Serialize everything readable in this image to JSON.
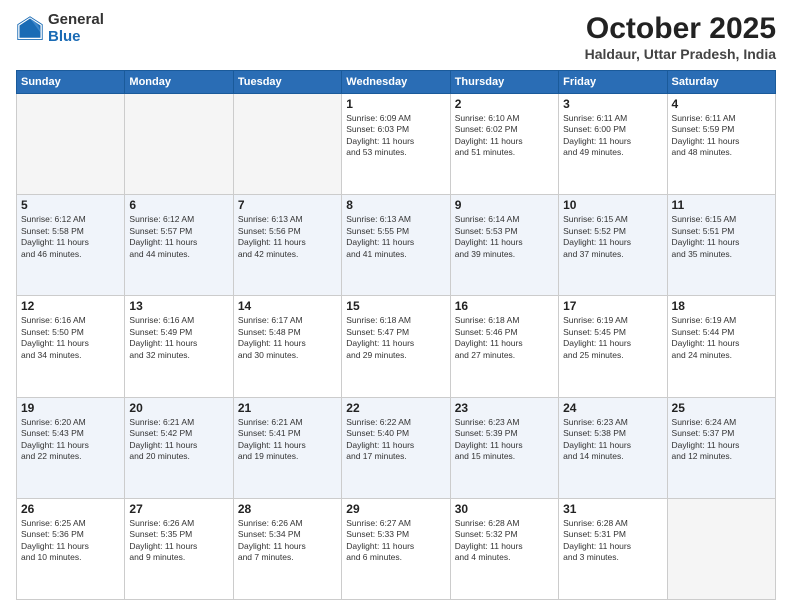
{
  "header": {
    "logo_general": "General",
    "logo_blue": "Blue",
    "title": "October 2025",
    "location": "Haldaur, Uttar Pradesh, India"
  },
  "weekdays": [
    "Sunday",
    "Monday",
    "Tuesday",
    "Wednesday",
    "Thursday",
    "Friday",
    "Saturday"
  ],
  "weeks": [
    [
      {
        "day": "",
        "info": ""
      },
      {
        "day": "",
        "info": ""
      },
      {
        "day": "",
        "info": ""
      },
      {
        "day": "1",
        "info": "Sunrise: 6:09 AM\nSunset: 6:03 PM\nDaylight: 11 hours\nand 53 minutes."
      },
      {
        "day": "2",
        "info": "Sunrise: 6:10 AM\nSunset: 6:02 PM\nDaylight: 11 hours\nand 51 minutes."
      },
      {
        "day": "3",
        "info": "Sunrise: 6:11 AM\nSunset: 6:00 PM\nDaylight: 11 hours\nand 49 minutes."
      },
      {
        "day": "4",
        "info": "Sunrise: 6:11 AM\nSunset: 5:59 PM\nDaylight: 11 hours\nand 48 minutes."
      }
    ],
    [
      {
        "day": "5",
        "info": "Sunrise: 6:12 AM\nSunset: 5:58 PM\nDaylight: 11 hours\nand 46 minutes."
      },
      {
        "day": "6",
        "info": "Sunrise: 6:12 AM\nSunset: 5:57 PM\nDaylight: 11 hours\nand 44 minutes."
      },
      {
        "day": "7",
        "info": "Sunrise: 6:13 AM\nSunset: 5:56 PM\nDaylight: 11 hours\nand 42 minutes."
      },
      {
        "day": "8",
        "info": "Sunrise: 6:13 AM\nSunset: 5:55 PM\nDaylight: 11 hours\nand 41 minutes."
      },
      {
        "day": "9",
        "info": "Sunrise: 6:14 AM\nSunset: 5:53 PM\nDaylight: 11 hours\nand 39 minutes."
      },
      {
        "day": "10",
        "info": "Sunrise: 6:15 AM\nSunset: 5:52 PM\nDaylight: 11 hours\nand 37 minutes."
      },
      {
        "day": "11",
        "info": "Sunrise: 6:15 AM\nSunset: 5:51 PM\nDaylight: 11 hours\nand 35 minutes."
      }
    ],
    [
      {
        "day": "12",
        "info": "Sunrise: 6:16 AM\nSunset: 5:50 PM\nDaylight: 11 hours\nand 34 minutes."
      },
      {
        "day": "13",
        "info": "Sunrise: 6:16 AM\nSunset: 5:49 PM\nDaylight: 11 hours\nand 32 minutes."
      },
      {
        "day": "14",
        "info": "Sunrise: 6:17 AM\nSunset: 5:48 PM\nDaylight: 11 hours\nand 30 minutes."
      },
      {
        "day": "15",
        "info": "Sunrise: 6:18 AM\nSunset: 5:47 PM\nDaylight: 11 hours\nand 29 minutes."
      },
      {
        "day": "16",
        "info": "Sunrise: 6:18 AM\nSunset: 5:46 PM\nDaylight: 11 hours\nand 27 minutes."
      },
      {
        "day": "17",
        "info": "Sunrise: 6:19 AM\nSunset: 5:45 PM\nDaylight: 11 hours\nand 25 minutes."
      },
      {
        "day": "18",
        "info": "Sunrise: 6:19 AM\nSunset: 5:44 PM\nDaylight: 11 hours\nand 24 minutes."
      }
    ],
    [
      {
        "day": "19",
        "info": "Sunrise: 6:20 AM\nSunset: 5:43 PM\nDaylight: 11 hours\nand 22 minutes."
      },
      {
        "day": "20",
        "info": "Sunrise: 6:21 AM\nSunset: 5:42 PM\nDaylight: 11 hours\nand 20 minutes."
      },
      {
        "day": "21",
        "info": "Sunrise: 6:21 AM\nSunset: 5:41 PM\nDaylight: 11 hours\nand 19 minutes."
      },
      {
        "day": "22",
        "info": "Sunrise: 6:22 AM\nSunset: 5:40 PM\nDaylight: 11 hours\nand 17 minutes."
      },
      {
        "day": "23",
        "info": "Sunrise: 6:23 AM\nSunset: 5:39 PM\nDaylight: 11 hours\nand 15 minutes."
      },
      {
        "day": "24",
        "info": "Sunrise: 6:23 AM\nSunset: 5:38 PM\nDaylight: 11 hours\nand 14 minutes."
      },
      {
        "day": "25",
        "info": "Sunrise: 6:24 AM\nSunset: 5:37 PM\nDaylight: 11 hours\nand 12 minutes."
      }
    ],
    [
      {
        "day": "26",
        "info": "Sunrise: 6:25 AM\nSunset: 5:36 PM\nDaylight: 11 hours\nand 10 minutes."
      },
      {
        "day": "27",
        "info": "Sunrise: 6:26 AM\nSunset: 5:35 PM\nDaylight: 11 hours\nand 9 minutes."
      },
      {
        "day": "28",
        "info": "Sunrise: 6:26 AM\nSunset: 5:34 PM\nDaylight: 11 hours\nand 7 minutes."
      },
      {
        "day": "29",
        "info": "Sunrise: 6:27 AM\nSunset: 5:33 PM\nDaylight: 11 hours\nand 6 minutes."
      },
      {
        "day": "30",
        "info": "Sunrise: 6:28 AM\nSunset: 5:32 PM\nDaylight: 11 hours\nand 4 minutes."
      },
      {
        "day": "31",
        "info": "Sunrise: 6:28 AM\nSunset: 5:31 PM\nDaylight: 11 hours\nand 3 minutes."
      },
      {
        "day": "",
        "info": ""
      }
    ]
  ]
}
